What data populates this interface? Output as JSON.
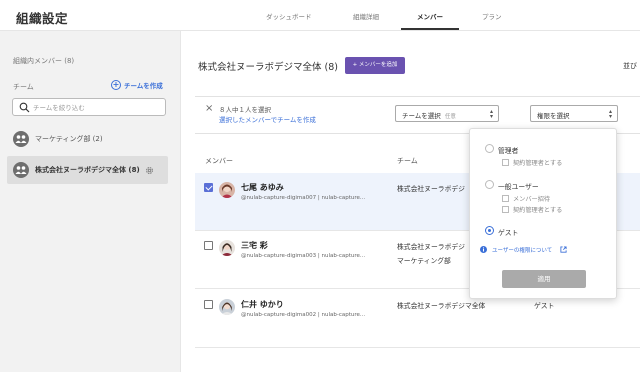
{
  "header": {
    "title": "組織設定",
    "tabs": [
      {
        "label": "ダッシュボード"
      },
      {
        "label": "組織詳細"
      },
      {
        "label": "メンバー"
      },
      {
        "label": "プラン"
      }
    ]
  },
  "sidebar": {
    "members_heading": "組織内メンバー (8)",
    "team_label": "チーム",
    "create_team": "チームを作成",
    "search_placeholder": "チームを絞り込む",
    "teams": [
      {
        "name": "マーケティング部 (2)"
      },
      {
        "name": "株式会社ヌーラボデジマ全体 (8)"
      }
    ]
  },
  "main": {
    "title": "株式会社ヌーラボデジマ全体 (8)",
    "add_member": "+ メンバーを追加",
    "sort_label": "並び",
    "selection": {
      "count_text": "８人中１人を選択",
      "create_team_link": "選択したメンバーでチームを作成"
    },
    "team_dropdown": {
      "label": "チームを選択",
      "optional": "任意"
    },
    "role_dropdown": {
      "label": "権限を選択"
    },
    "columns": {
      "member": "メンバー",
      "team": "チーム"
    },
    "members": [
      {
        "name": "七尾 あゆみ",
        "id": "@nulab-capture-digima007 | nulab-capture...",
        "team": "株式会社ヌーラボデジ",
        "team2": "",
        "role": "",
        "checked": true
      },
      {
        "name": "三宅 彩",
        "id": "@nulab-capture-digima003 | nulab-capture...",
        "team": "株式会社ヌーラボデジ",
        "team2": "マーケティング部",
        "role": "",
        "checked": false
      },
      {
        "name": "仁井 ゆかり",
        "id": "@nulab-capture-digima002 | nulab-capture...",
        "team": "株式会社ヌーラボデジマ全体",
        "team2": "",
        "role": "ゲスト",
        "checked": false
      }
    ]
  },
  "popup": {
    "admin": "管理者",
    "contract_admin": "契約管理者とする",
    "general_user": "一般ユーザー",
    "member_invite": "メンバー招待",
    "contract_admin_2": "契約管理者とする",
    "guest": "ゲスト",
    "about_roles": "ユーザーの権限について",
    "apply": "適用"
  },
  "colors": {
    "accent": "#6a52b0",
    "link": "#3a6fd8",
    "checkbox": "#5a6fd6"
  }
}
